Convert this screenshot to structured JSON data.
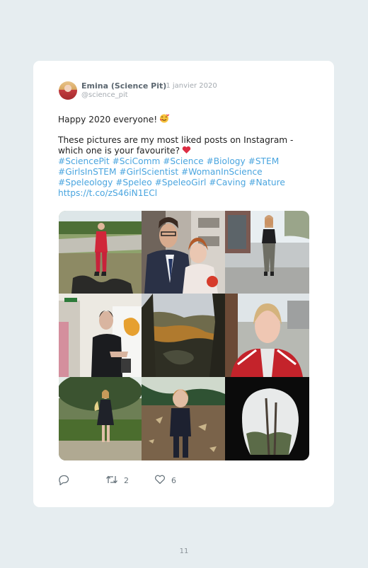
{
  "post": {
    "author_name": "Emina (Science Pit)",
    "date": "· 1 janvier 2020",
    "handle": "@science_pit",
    "line1": "Happy 2020 everyone!",
    "line2": "These pictures are my most liked posts on Instagram -",
    "line3": "which one is your favourite?",
    "tags1": "#SciencePit #SciComm #Science #Biology #STEM",
    "tags2": "#GirlsInSTEM #GirlScientist #WomanInScience",
    "tags3": "#Speleology #Speleo #SpeleoGirl #Caving #Nature",
    "link": "https://t.co/zS46iN1ECl"
  },
  "photos": [
    {
      "caption": "field-road-red-suit"
    },
    {
      "caption": "couple-formal"
    },
    {
      "caption": "street-black-top"
    },
    {
      "caption": "lab-presentation"
    },
    {
      "caption": "valley-autumn"
    },
    {
      "caption": "selfie-red-jacket"
    },
    {
      "caption": "park-dress"
    },
    {
      "caption": "forest-path"
    },
    {
      "caption": "cave-entrance"
    }
  ],
  "actions": {
    "reply_count": "",
    "retweet_count": "2",
    "like_count": "6"
  },
  "footer": {
    "page_number": "11"
  },
  "colors": {
    "link": "#4aa5df",
    "background": "#e6edf0",
    "heart": "#e0245e"
  },
  "icons": {
    "emoji1": "smiling-face-with-hearts-icon",
    "emoji2": "red-heart-icon"
  }
}
